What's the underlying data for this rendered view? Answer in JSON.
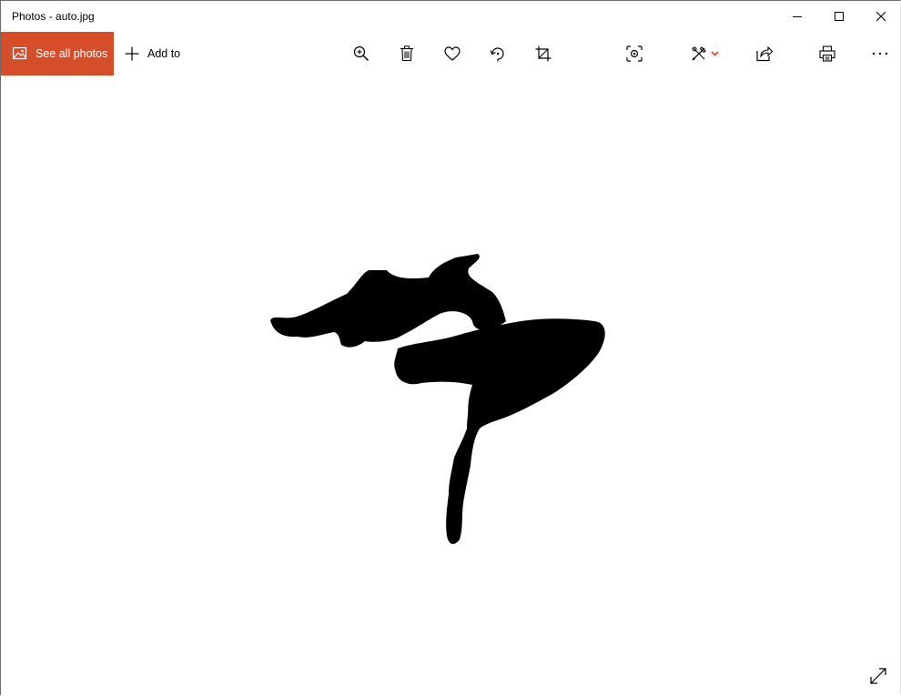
{
  "window": {
    "title": "Photos - auto.jpg",
    "controls": [
      "minimize-icon",
      "maximize-icon",
      "close-icon"
    ]
  },
  "toolbar": {
    "see_all_label": "See all photos",
    "add_to_label": "Add to",
    "accent_color": "#d64d2a",
    "tools": [
      "zoom-in-icon",
      "delete-icon",
      "favorite-heart-icon",
      "rotate-icon",
      "crop-icon",
      "visual-search-icon",
      "edit-draw-icon",
      "share-icon",
      "print-icon",
      "more-options-icon"
    ]
  },
  "image": {
    "filename": "auto.jpg",
    "content": "black ink brush character on white background"
  }
}
